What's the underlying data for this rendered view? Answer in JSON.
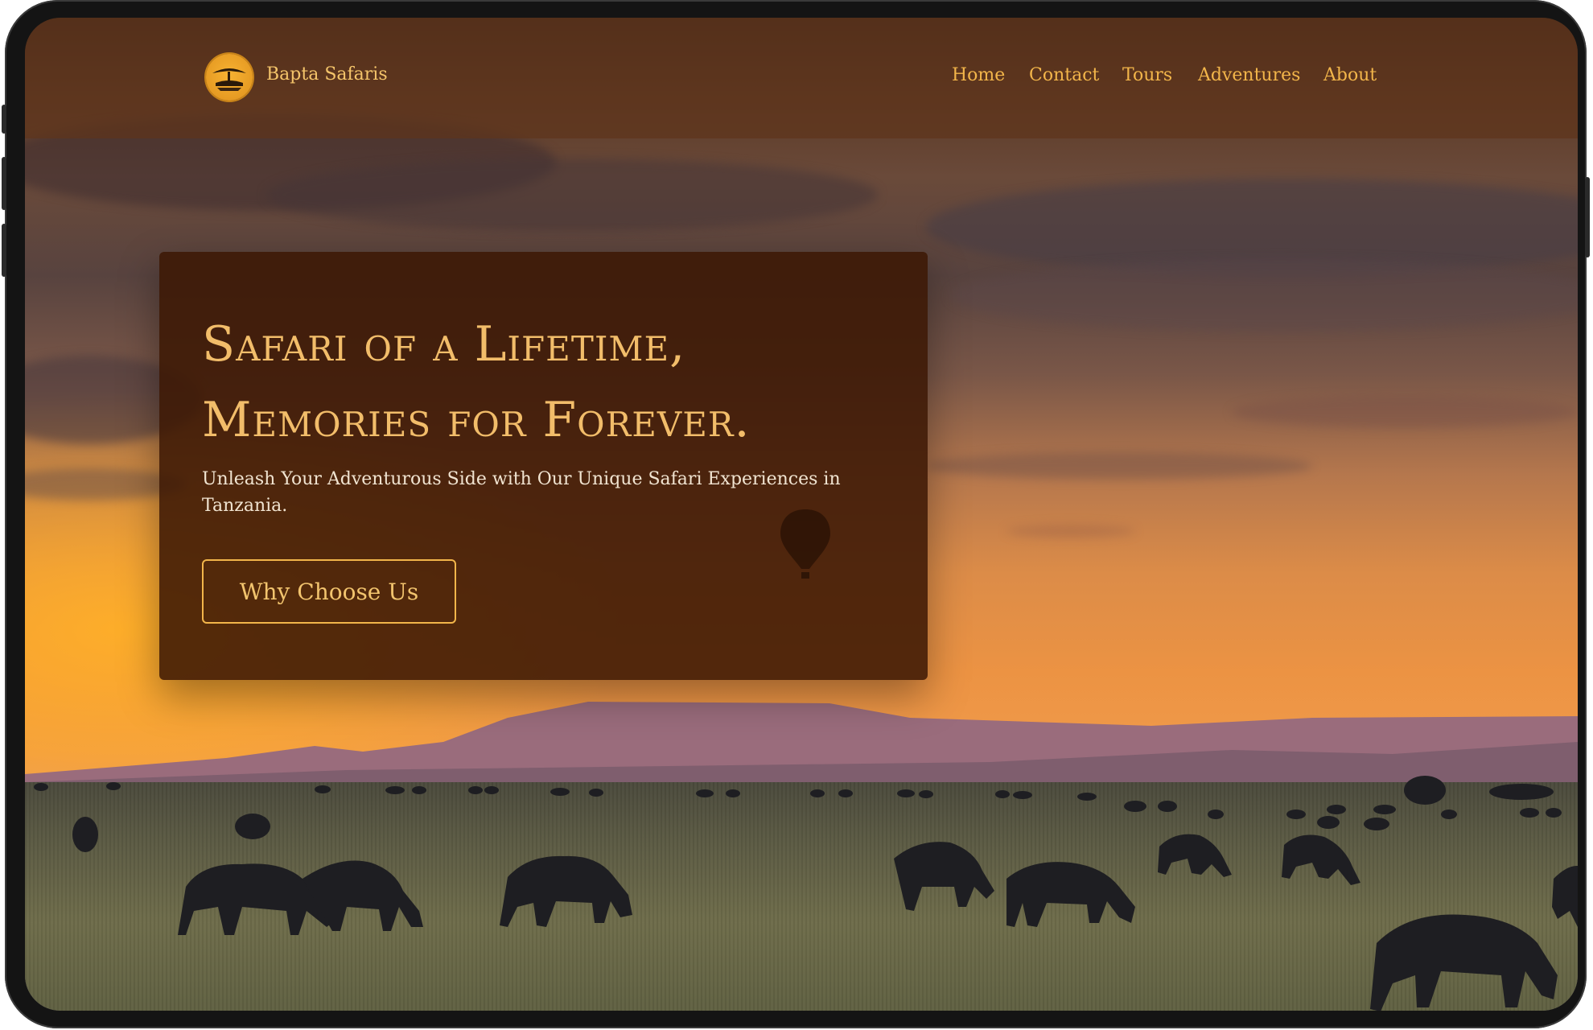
{
  "brand": {
    "name": "Bapta Safaris",
    "logo_icon": "safari-tree-logo-icon"
  },
  "nav": {
    "items": [
      {
        "label": "Home"
      },
      {
        "label": "Contact"
      },
      {
        "label": "Tours"
      },
      {
        "label": "Adventures"
      },
      {
        "label": "About"
      }
    ]
  },
  "hero": {
    "title_line1": "Safari of a Lifetime,",
    "title_line2": "Memories for Forever.",
    "subtitle": "Unleash Your Adventurous Side with Our Unique Safari Experiences in Tanzania.",
    "cta_label": "Why Choose Us",
    "balloon_icon": "hot-air-balloon-icon"
  },
  "colors": {
    "accent": "#f2b54a",
    "card_bg": "#3c1804",
    "header_bg": "#5e341c"
  }
}
